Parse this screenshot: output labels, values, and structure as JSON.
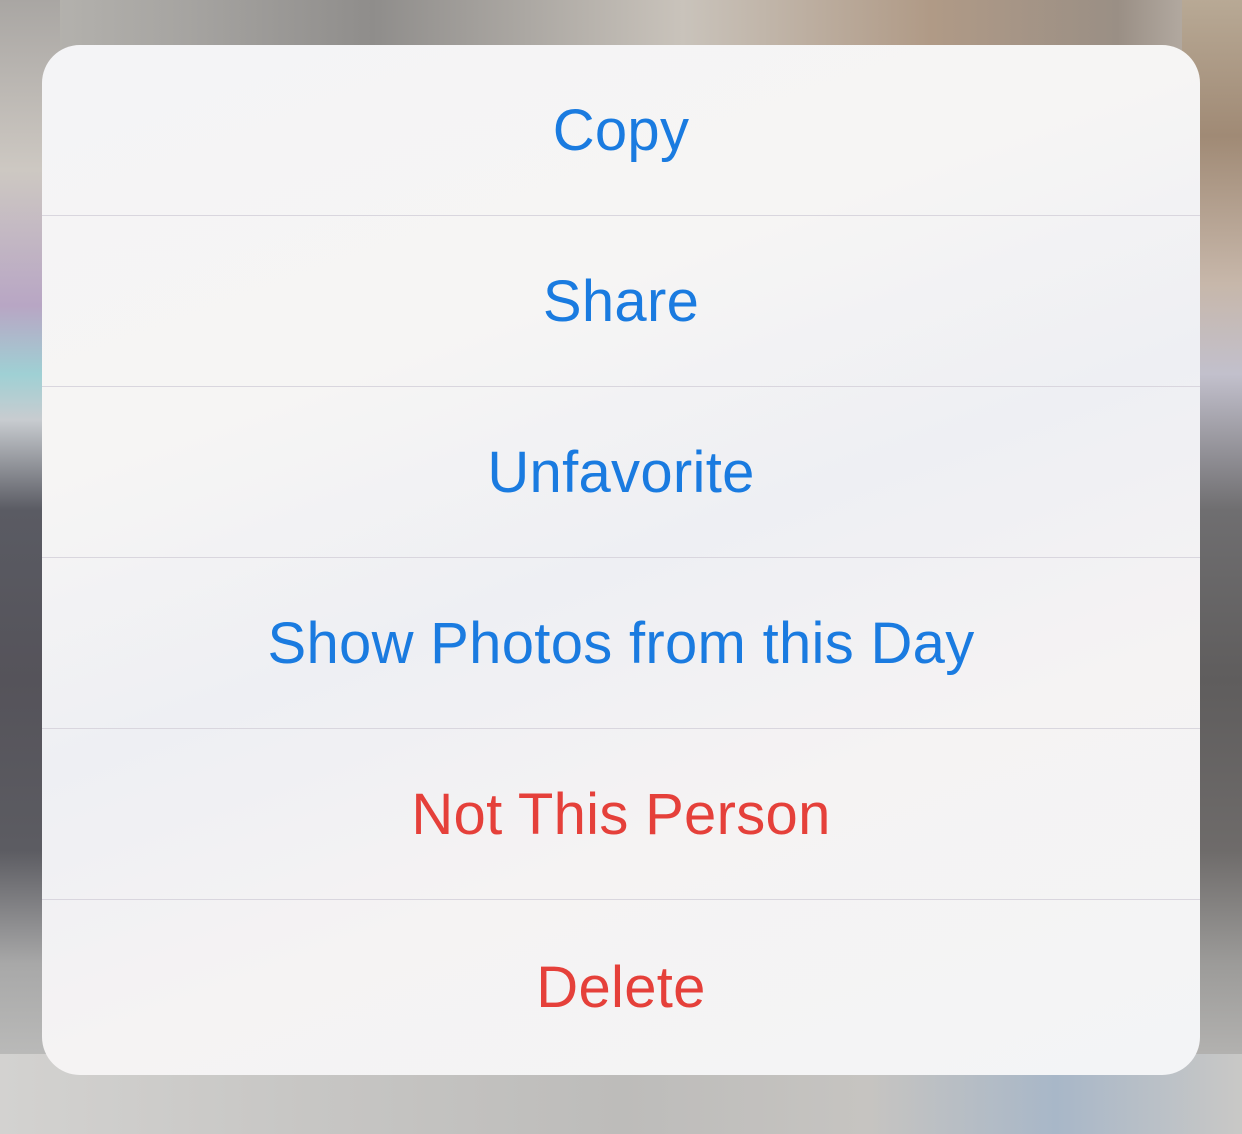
{
  "colors": {
    "accent": "#1a7be0",
    "danger": "#e5403a"
  },
  "menu": {
    "items": [
      {
        "label": "Copy",
        "style": "default"
      },
      {
        "label": "Share",
        "style": "default"
      },
      {
        "label": "Unfavorite",
        "style": "default"
      },
      {
        "label": "Show Photos from this Day",
        "style": "default"
      },
      {
        "label": "Not This Person",
        "style": "destructive"
      },
      {
        "label": "Delete",
        "style": "destructive"
      }
    ]
  }
}
